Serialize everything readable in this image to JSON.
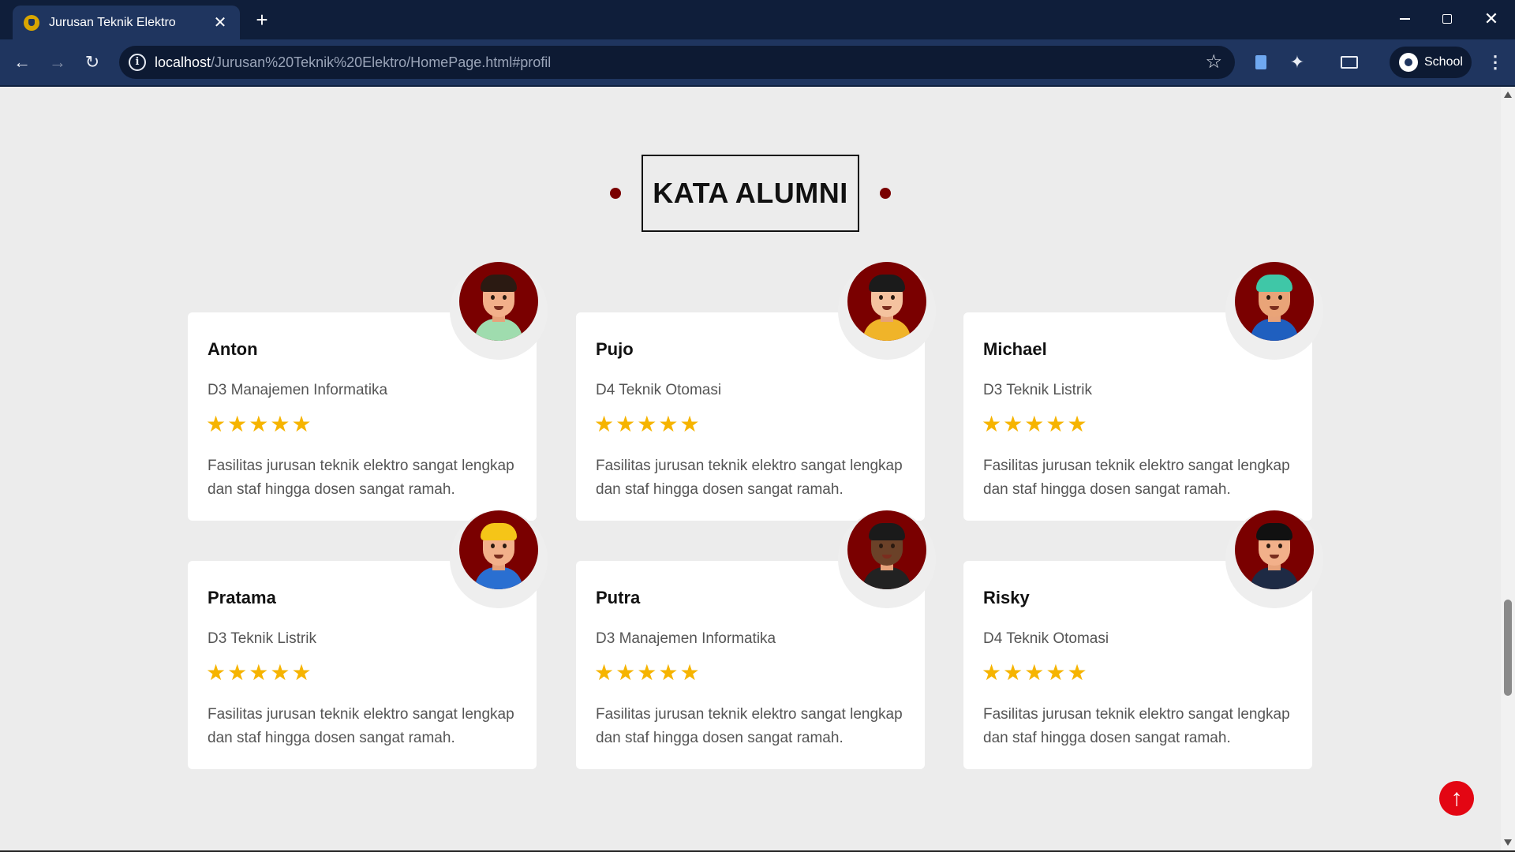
{
  "browser": {
    "tab_title": "Jurusan Teknik Elektro",
    "tab_close": "✕",
    "new_tab": "+",
    "url_host": "localhost",
    "url_path": "/Jurusan%20Teknik%20Elektro/HomePage.html#profil",
    "profile_name": "School",
    "icons": [
      "back-arrow-icon",
      "forward-arrow-icon",
      "reload-icon",
      "site-info-icon",
      "bookmark-star-icon",
      "extension-icon",
      "puzzle-icon",
      "cast-icon",
      "profile-icon",
      "kebab-menu-icon"
    ]
  },
  "section": {
    "title": "KATA ALUMNI",
    "dot_color": "#7a0000"
  },
  "testimonials": [
    {
      "name": "Anton",
      "program": "D3 Manajemen Informatika",
      "rating": 5,
      "text": "Fasilitas jurusan teknik elektro sangat lengkap dan staf hingga dosen sangat ramah.",
      "avatar": "avatar-boy-green-shirt"
    },
    {
      "name": "Pujo",
      "program": "D4 Teknik Otomasi",
      "rating": 5,
      "text": "Fasilitas jurusan teknik elektro sangat lengkap dan staf hingga dosen sangat ramah.",
      "avatar": "avatar-man-yellow-jacket"
    },
    {
      "name": "Michael",
      "program": "D3 Teknik Listrik",
      "rating": 5,
      "text": "Fasilitas jurusan teknik elektro sangat lengkap dan staf hingga dosen sangat ramah.",
      "avatar": "avatar-man-blue-hoodie"
    },
    {
      "name": "Pratama",
      "program": "D3 Teknik Listrik",
      "rating": 5,
      "text": "Fasilitas jurusan teknik elektro sangat lengkap dan staf hingga dosen sangat ramah.",
      "avatar": "avatar-worker-hardhat"
    },
    {
      "name": "Putra",
      "program": "D3 Manajemen Informatika",
      "rating": 5,
      "text": "Fasilitas jurusan teknik elektro sangat lengkap dan staf hingga dosen sangat ramah.",
      "avatar": "avatar-man-dreadlocks"
    },
    {
      "name": "Risky",
      "program": "D4 Teknik Otomasi",
      "rating": 5,
      "text": "Fasilitas jurusan teknik elektro sangat lengkap dan staf hingga dosen sangat ramah.",
      "avatar": "avatar-graduate-cap"
    }
  ],
  "colors": {
    "star": "#f6b400",
    "avatar_bg": "#7a0000",
    "back_to_top": "#e30613"
  },
  "back_to_top_icon": "arrow-up-icon"
}
